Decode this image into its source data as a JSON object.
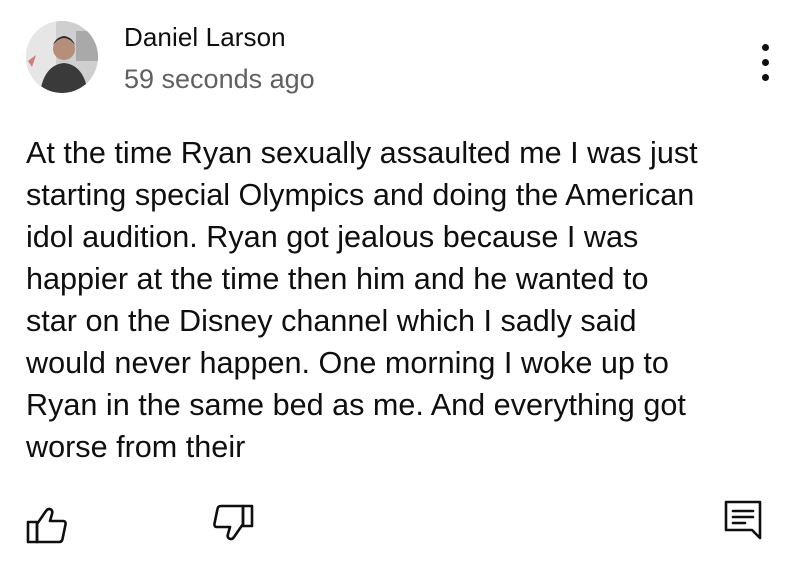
{
  "comment": {
    "author": "Daniel Larson",
    "timestamp": "59 seconds ago",
    "text": "At the time Ryan sexually assaulted me I was just\nstarting special Olympics and doing the American\nidol audition. Ryan got jealous because I was\nhappier at the time then him and he wanted to\nstar on the Disney channel which I sadly said\nwould never happen. One morning I woke up to\nRyan in the same bed as me. And everything got\nworse from their"
  },
  "icons": {
    "avatar": "user-photo-avatar",
    "more": "more-vertical-icon",
    "like": "thumbs-up-icon",
    "dislike": "thumbs-down-icon",
    "reply": "comment-reply-icon"
  },
  "colors": {
    "text": "#0f0f0f",
    "secondary_text": "#606060",
    "background": "#ffffff"
  }
}
